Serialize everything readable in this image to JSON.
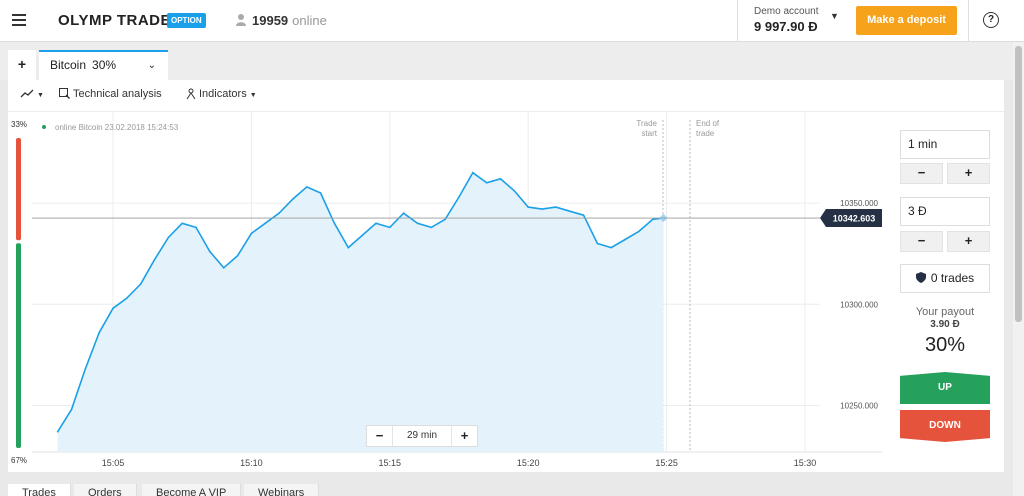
{
  "header": {
    "logo_text": "OLYMP TRADE",
    "logo_badge": "OPTION",
    "online_count": "19959",
    "online_label": "online",
    "account_label": "Demo account",
    "account_balance": "9 997.90 Đ",
    "deposit_label": "Make a deposit",
    "help_label": "?"
  },
  "tabs": {
    "add_label": "+",
    "asset_name": "Bitcoin",
    "asset_payout": "30%"
  },
  "toolbar": {
    "technical_analysis": "Technical analysis",
    "indicators": "Indicators"
  },
  "chart_info": {
    "legend_text": "online Bitcoin  23.02.2018 15:24:53",
    "sentiment_up": "33%",
    "sentiment_down": "67%",
    "sentiment_up_fraction": 0.33,
    "trade_start_line1": "Trade",
    "trade_start_line2": "start",
    "end_trade_line1": "End of",
    "end_trade_line2": "trade",
    "current_price_label": "10342.603"
  },
  "chart_data": {
    "type": "area",
    "series": [
      {
        "x": [
          "15:03:00",
          "15:03:30",
          "15:04:00",
          "15:04:30",
          "15:05:00",
          "15:05:30",
          "15:06:00",
          "15:06:30",
          "15:07:00",
          "15:07:30",
          "15:08:00",
          "15:08:30",
          "15:09:00",
          "15:09:30",
          "15:10:00",
          "15:10:30",
          "15:11:00",
          "15:11:30",
          "15:12:00",
          "15:12:30",
          "15:13:00",
          "15:13:30",
          "15:14:00",
          "15:14:30",
          "15:15:00",
          "15:15:30",
          "15:16:00",
          "15:16:30",
          "15:17:00",
          "15:17:30",
          "15:18:00",
          "15:18:30",
          "15:19:00",
          "15:19:30",
          "15:20:00",
          "15:20:30",
          "15:21:00",
          "15:21:30",
          "15:22:00",
          "15:22:30",
          "15:23:00",
          "15:23:30",
          "15:24:00",
          "15:24:30",
          "15:24:53"
        ],
        "y": [
          10237,
          10248,
          10268,
          10286,
          10298,
          10303,
          10310,
          10322,
          10333,
          10340,
          10338,
          10326,
          10318,
          10324,
          10335,
          10340,
          10345,
          10352,
          10358,
          10355,
          10340,
          10328,
          10334,
          10340,
          10338,
          10345,
          10340,
          10338,
          10342,
          10353,
          10365,
          10360,
          10362,
          10356,
          10348,
          10347,
          10348,
          10346,
          10344,
          10330,
          10328,
          10332,
          10336,
          10342,
          10342.603
        ]
      }
    ],
    "x_ticks": [
      "15:05",
      "15:10",
      "15:15",
      "15:20",
      "15:25",
      "15:30"
    ],
    "y_ticks": [
      "10350.000",
      "10300.000",
      "10250.000"
    ],
    "y_tick_values": [
      10350,
      10300,
      10250
    ],
    "ylim": [
      10227,
      10395
    ],
    "grid": true
  },
  "sidebar": {
    "duration": "1 min",
    "amount": "3 Đ",
    "minus": "−",
    "plus": "+",
    "trades_label": "0 trades",
    "payout_label": "Your payout",
    "payout_amount": "3.90 Đ",
    "payout_pct": "30%",
    "up_label": "UP",
    "down_label": "DOWN"
  },
  "zoom": {
    "minus": "−",
    "value": "29 min",
    "plus": "+"
  },
  "bottom_tabs": [
    "Trades",
    "Orders",
    "Become A VIP",
    "Webinars"
  ],
  "colors": {
    "accent": "#1aa0e8",
    "deposit": "#f7a21b",
    "up": "#25a15c",
    "down": "#e5533c",
    "area_fill": "#e3f2fb",
    "price_tag": "#253045"
  }
}
